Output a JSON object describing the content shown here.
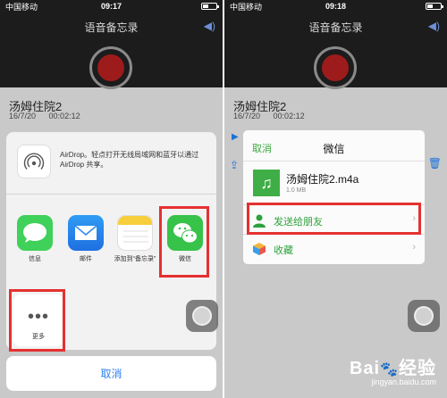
{
  "left_phone": {
    "status": {
      "carrier": "中国移动",
      "time": "09:17",
      "battery_level": 0.4
    },
    "recorder_title": "语音备忘录",
    "recording": {
      "name": "汤姆住院2",
      "date": "16/7/20",
      "duration": "00:02:12"
    },
    "airdrop": {
      "text": "AirDrop。轻点打开无线局域网和蓝牙以通过AirDrop 共享。"
    },
    "apps": [
      {
        "label": "信息",
        "icon": "messages-icon"
      },
      {
        "label": "邮件",
        "icon": "mail-icon"
      },
      {
        "label": "添加到“备忘录”",
        "icon": "notes-icon"
      },
      {
        "label": "微信",
        "icon": "wechat-icon"
      }
    ],
    "more": {
      "label": "更多",
      "icon": "more-dots-icon",
      "glyph": "•••"
    },
    "cancel_label": "取消"
  },
  "right_phone": {
    "status": {
      "carrier": "中国移动",
      "time": "09:18",
      "battery_level": 0.4
    },
    "recorder_title": "语音备忘录",
    "recording": {
      "name": "汤姆住院2",
      "date": "16/7/20",
      "duration": "00:02:12"
    },
    "dialog": {
      "cancel_label": "取消",
      "title": "微信",
      "file": {
        "name": "汤姆住院2.m4a",
        "size": "1.0 MB",
        "icon": "music-file-icon"
      },
      "actions": [
        {
          "label": "发送给朋友",
          "icon": "friend-icon"
        },
        {
          "label": "收藏",
          "icon": "favorites-cube-icon"
        }
      ]
    }
  },
  "watermark": {
    "brand_left": "Bai",
    "brand_right": "经验",
    "url": "jingyan.baidu.com"
  },
  "colors": {
    "accent_blue": "#2f80ed",
    "wechat_green": "#37c24a",
    "highlight_red": "#e53030",
    "record_red": "#9e1b1b"
  }
}
